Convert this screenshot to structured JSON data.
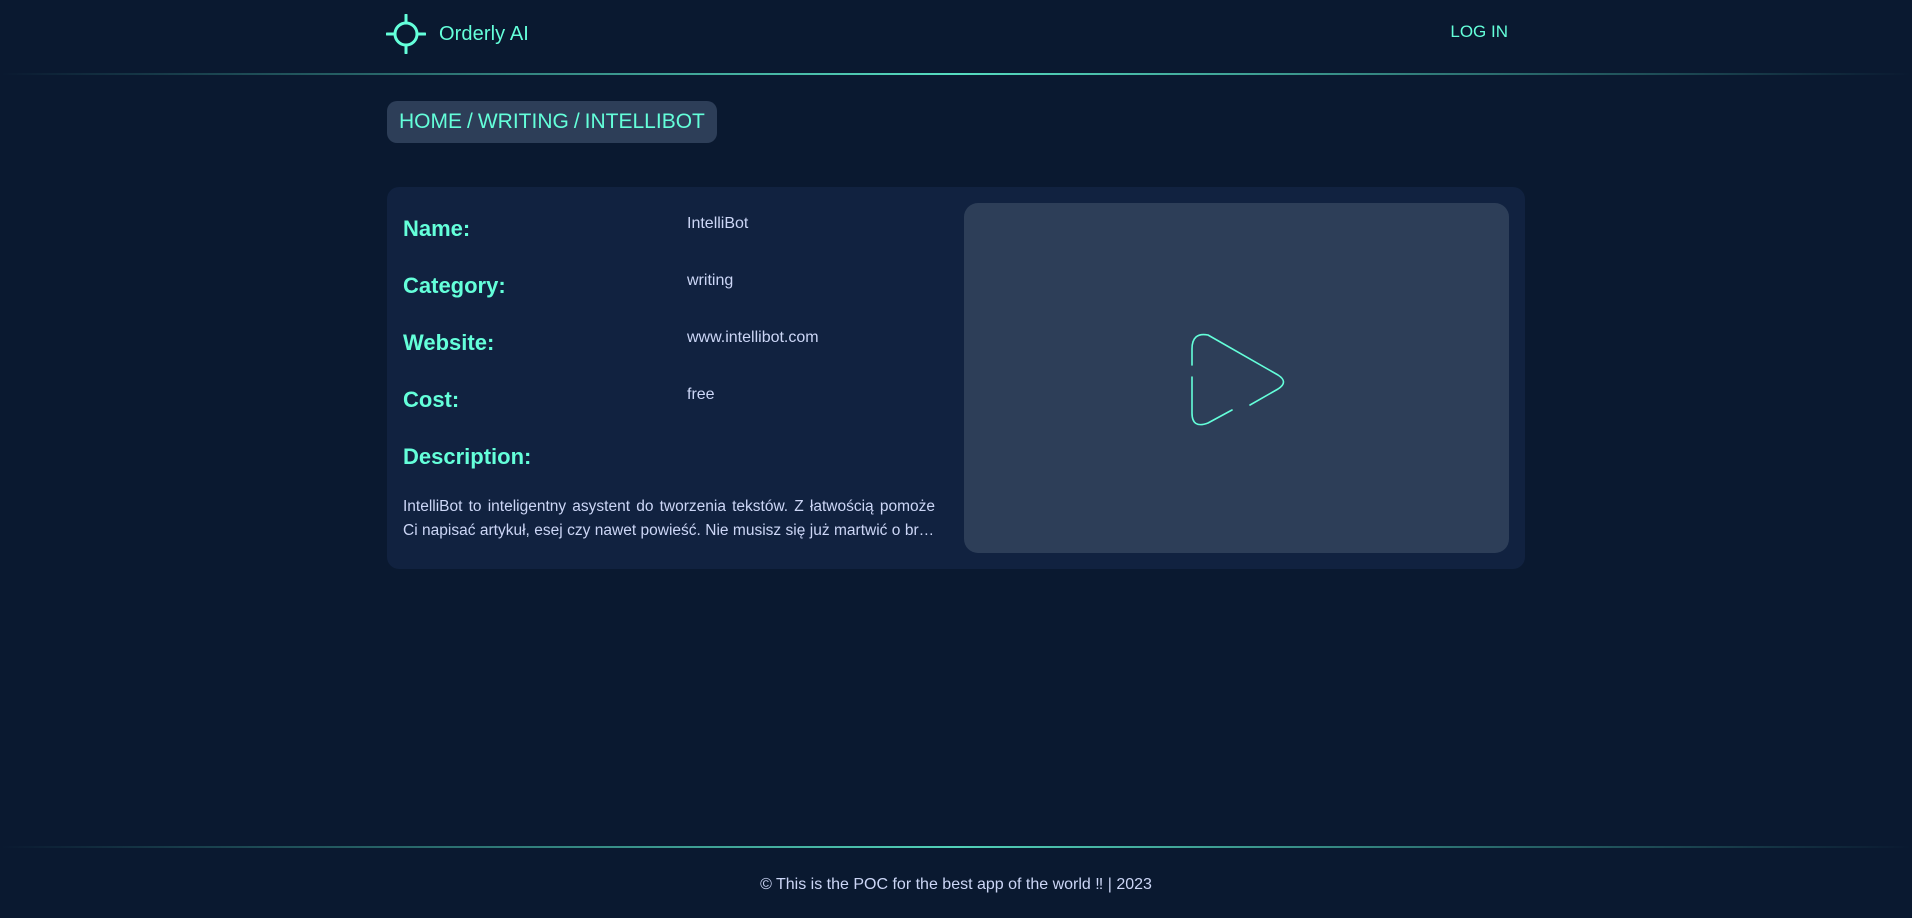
{
  "header": {
    "brand_name": "Orderly AI",
    "brand_icon": "crosshair-icon",
    "login_label": "LOG IN"
  },
  "breadcrumb": {
    "items": [
      "HOME",
      "WRITING",
      "INTELLIBOT"
    ],
    "separator": "/"
  },
  "tool": {
    "fields": [
      {
        "label": "Name:",
        "value": "IntelliBot"
      },
      {
        "label": "Category:",
        "value": "writing"
      },
      {
        "label": "Website:",
        "value": "www.intellibot.com"
      },
      {
        "label": "Cost:",
        "value": "free"
      }
    ],
    "description_label": "Description:",
    "description": "IntelliBot to inteligentny asystent do tworzenia tekstów. Z łatwością pomoże Ci napisać artykuł, esej czy nawet powieść. Nie musisz się już martwić o brak weny czy czas potrzebny na pisanie."
  },
  "video": {
    "icon": "play-icon"
  },
  "footer": {
    "text": "© This is the POC for the best app of the world ‼ | 2023"
  },
  "colors": {
    "background": "#0a1930",
    "card": "#112240",
    "panel": "#2d3e58",
    "accent": "#64ffda",
    "text": "#ccd6f6"
  }
}
